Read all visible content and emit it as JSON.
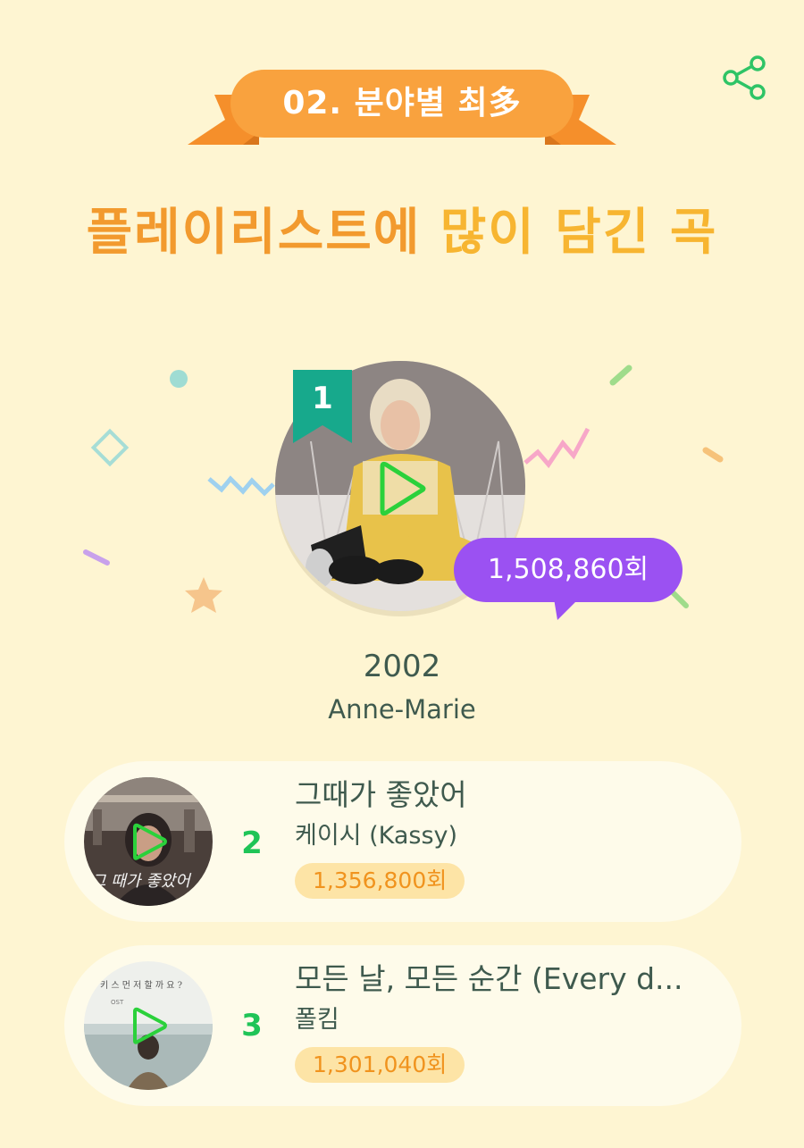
{
  "header": {
    "badge_label": "02. 분야별 최多",
    "headline_part1": "플레이리스트에",
    "headline_part2": "많이 담긴 곡",
    "share_icon": "share-icon"
  },
  "colors": {
    "background": "#fef5d2",
    "ribbon": "#f79a36",
    "headline_orange": "#f29a2e",
    "headline_yellow": "#f7b531",
    "rank_badge": "#17a98c",
    "bubble": "#9b51f2",
    "count_pill": "#fde4a6",
    "accent_green": "#1fc457",
    "text": "#3f5a4e"
  },
  "top_track": {
    "rank": "1",
    "count": "1,508,860회",
    "title": "2002",
    "artist": "Anne-Marie",
    "play_icon": "play-icon"
  },
  "tracks": [
    {
      "rank": "2",
      "title": "그때가 좋았어",
      "artist": "케이시 (Kassy)",
      "count": "1,356,800회"
    },
    {
      "rank": "3",
      "title": "모든 날, 모든 순간 (Every d...",
      "artist": "폴킴",
      "count": "1,301,040회"
    }
  ]
}
